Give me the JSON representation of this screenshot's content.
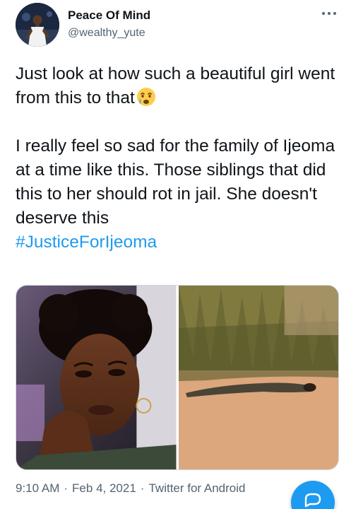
{
  "author": {
    "name": "Peace Of Mind",
    "handle": "@wealthy_yute"
  },
  "tweet": {
    "line1": "Just look at how such a beautiful girl went from this to that",
    "emoji": "crying-face-icon",
    "paragraph2": "I really feel so sad for the family of Ijeoma at a time like this. Those siblings that did this to her should rot in jail. She doesn't deserve this",
    "hashtag": "#JusticeForIjeoma"
  },
  "media": {
    "count": 2,
    "photos": [
      "portrait-photo",
      "roadside-photo"
    ]
  },
  "meta": {
    "time": "9:10 AM",
    "separator": "·",
    "date": "Feb 4, 2021",
    "source": "Twitter for Android"
  },
  "colors": {
    "accent": "#1d9bf0",
    "text": "#0f1419",
    "secondary": "#536471"
  },
  "icons": {
    "more": "more-options-icon",
    "compose": "compose-fab"
  }
}
